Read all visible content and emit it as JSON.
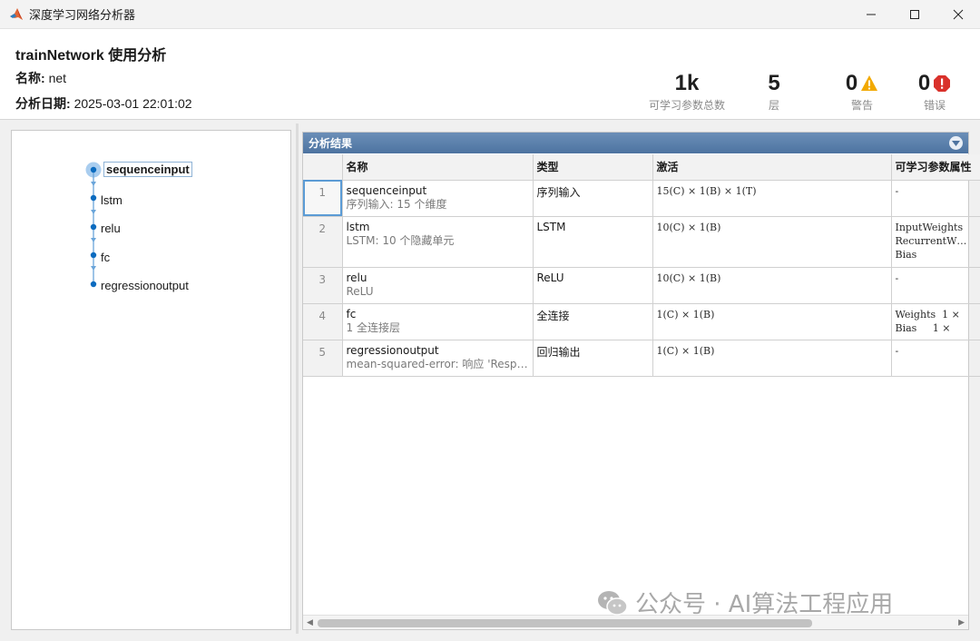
{
  "window": {
    "title": "深度学习网络分析器"
  },
  "header": {
    "title": "trainNetwork 使用分析",
    "name_label": "名称:",
    "name_value": "net",
    "date_label": "分析日期:",
    "date_value": "2025-03-01 22:01:02",
    "stats": [
      {
        "value": "1k",
        "label": "可学习参数总数",
        "icon": ""
      },
      {
        "value": "5",
        "label": "层",
        "icon": ""
      },
      {
        "value": "0",
        "label": "警告",
        "icon": "warning-icon",
        "color": "#f2a900"
      },
      {
        "value": "0",
        "label": "错误",
        "icon": "error-icon",
        "color": "#d9312b"
      }
    ]
  },
  "graph": {
    "nodes": [
      "sequenceinput",
      "lstm",
      "relu",
      "fc",
      "regressionoutput"
    ],
    "selected_index": 0,
    "colors": {
      "node": "#0b6bbf",
      "edge": "#6aa5da",
      "selected_halo": "#a9cdef"
    }
  },
  "results": {
    "title": "分析结果",
    "columns": [
      "",
      "名称",
      "类型",
      "激活",
      "可学习参数属性"
    ],
    "rows": [
      {
        "index": "1",
        "name": "sequenceinput",
        "desc": "序列输入: 15 个维度",
        "type": "序列输入",
        "activation": "15(C) × 1(B) × 1(T)",
        "params": "-"
      },
      {
        "index": "2",
        "name": "lstm",
        "desc": "LSTM: 10 个隐藏单元",
        "type": "LSTM",
        "activation": "10(C) × 1(B)",
        "params": "InputWeights\nRecurrentW…\nBias"
      },
      {
        "index": "3",
        "name": "relu",
        "desc": "ReLU",
        "type": "ReLU",
        "activation": "10(C) × 1(B)",
        "params": "-"
      },
      {
        "index": "4",
        "name": "fc",
        "desc": "1 全连接层",
        "type": "全连接",
        "activation": "1(C) × 1(B)",
        "params": "Weights  1 ×\nBias     1 ×"
      },
      {
        "index": "5",
        "name": "regressionoutput",
        "desc": "mean-squared-error: 响应 'Response'",
        "type": "回归输出",
        "activation": "1(C) × 1(B)",
        "params": "-"
      }
    ]
  },
  "watermark": {
    "text": "公众号 · AI算法工程应用"
  }
}
